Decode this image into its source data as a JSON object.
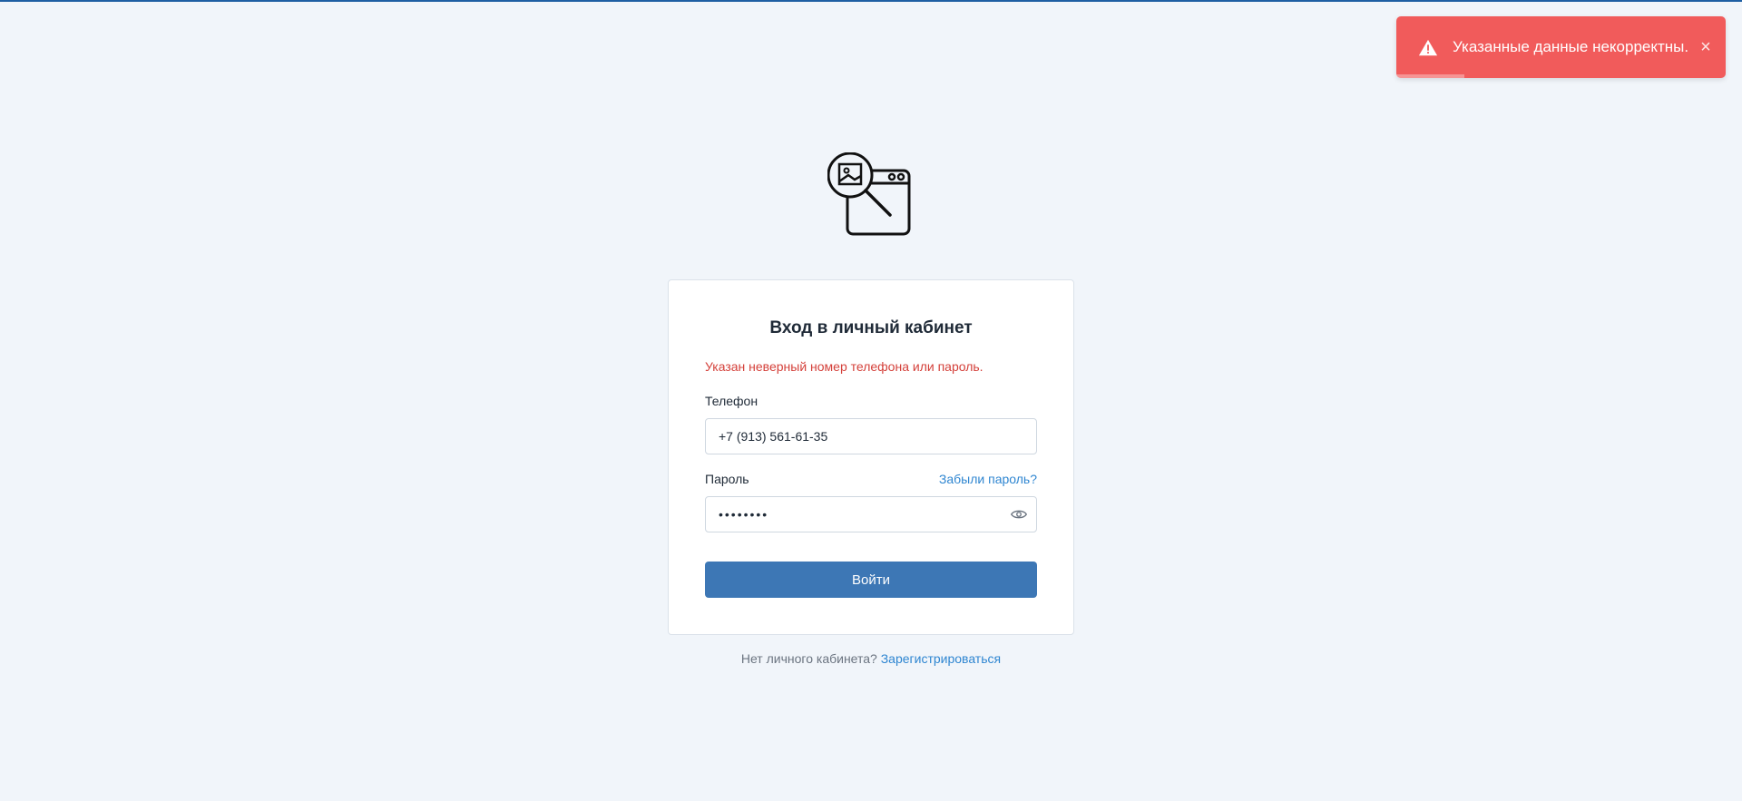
{
  "toast": {
    "message": "Указанные данные некорректны.",
    "close_symbol": "×",
    "icon": "warning-icon",
    "color": "#f15b5b"
  },
  "logo": {
    "icon": "image-search-browser-icon"
  },
  "login": {
    "title": "Вход в личный кабинет",
    "error": "Указан неверный номер телефона или пароль.",
    "phone_label": "Телефон",
    "phone_value": "+7 (913) 561-61-35",
    "password_label": "Пароль",
    "password_value": "••••••••",
    "forgot_link": "Забыли пароль?",
    "submit_label": "Войти",
    "eye_icon": "eye-icon",
    "accent_color": "#3d77b5",
    "error_color": "#d4403a"
  },
  "footer": {
    "no_account_text": "Нет личного кабинета?",
    "register_link": "Зарегистрироваться"
  }
}
